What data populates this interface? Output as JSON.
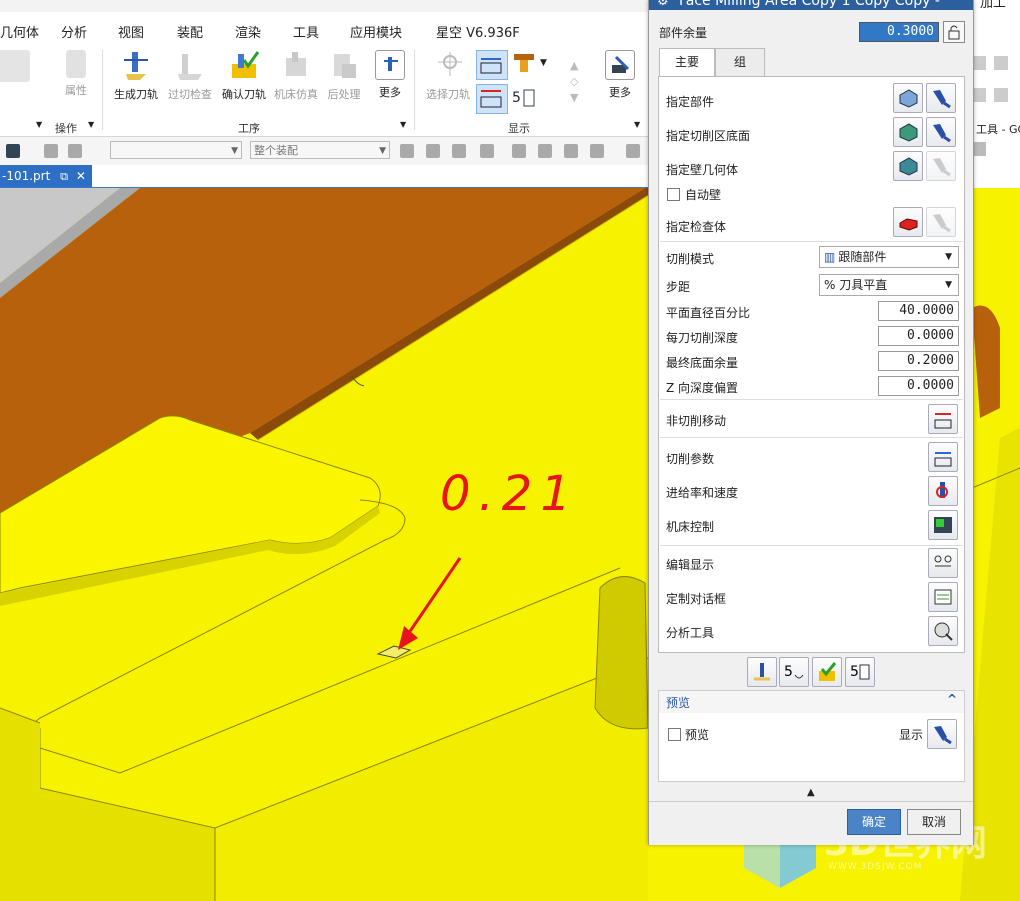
{
  "menu": {
    "items": [
      "几何体",
      "分析",
      "视图",
      "装配",
      "渲染",
      "工具",
      "应用模块",
      "星空 V6.936F"
    ]
  },
  "ribbon": {
    "left_label": "属性",
    "ops_group": "操作",
    "gongxu_group": "工序",
    "display_group": "显示",
    "buttons": [
      "生成刀轨",
      "过切检查",
      "确认刀轨",
      "机床仿真",
      "后处理",
      "更多"
    ],
    "display_buttons": [
      "选择刀轨",
      "更多"
    ],
    "right_fragment": "工具 - GC",
    "top_fragment": "加工"
  },
  "toolbar2": {
    "assembly_combo": "整个装配"
  },
  "file_tab": {
    "name": "-101.prt"
  },
  "annotation": {
    "text": "0.21",
    "color": "#e8141c"
  },
  "dialog": {
    "title": "Face Milling Area Copy 1 Copy Copy -",
    "stock_label": "部件余量",
    "stock_value": "0.3000",
    "tabs": [
      "主要",
      "组"
    ],
    "geometry": {
      "specify_part": "指定部件",
      "specify_cut_floor": "指定切削区底面",
      "specify_wall": "指定壁几何体",
      "auto_wall": "自动壁",
      "specify_check": "指定检查体"
    },
    "cut_mode_label": "切削模式",
    "cut_mode_value": "跟随部件",
    "stepover_label": "步距",
    "stepover_value": "% 刀具平直",
    "percent_label": "平面直径百分比",
    "percent_value": "40.0000",
    "depth_label": "每刀切削深度",
    "depth_value": "0.0000",
    "floor_stock_label": "最终底面余量",
    "floor_stock_value": "0.2000",
    "zoffset_label": "Z 向深度偏置",
    "zoffset_value": "0.0000",
    "non_cut": "非切削移动",
    "cut_params": "切削参数",
    "feeds": "进给率和速度",
    "machine_control": "机床控制",
    "edit_display": "编辑显示",
    "customize": "定制对话框",
    "analysis": "分析工具",
    "preview_section": "预览",
    "preview_check": "预览",
    "display_label": "显示",
    "ok": "确定",
    "cancel": "取消"
  },
  "watermark": {
    "text": "3D世界网",
    "url": "WWW.3DSJW.COM"
  },
  "colors": {
    "part_yellow": "#f7f200",
    "copper": "#b8610d",
    "title_blue": "#2c5f9e"
  }
}
